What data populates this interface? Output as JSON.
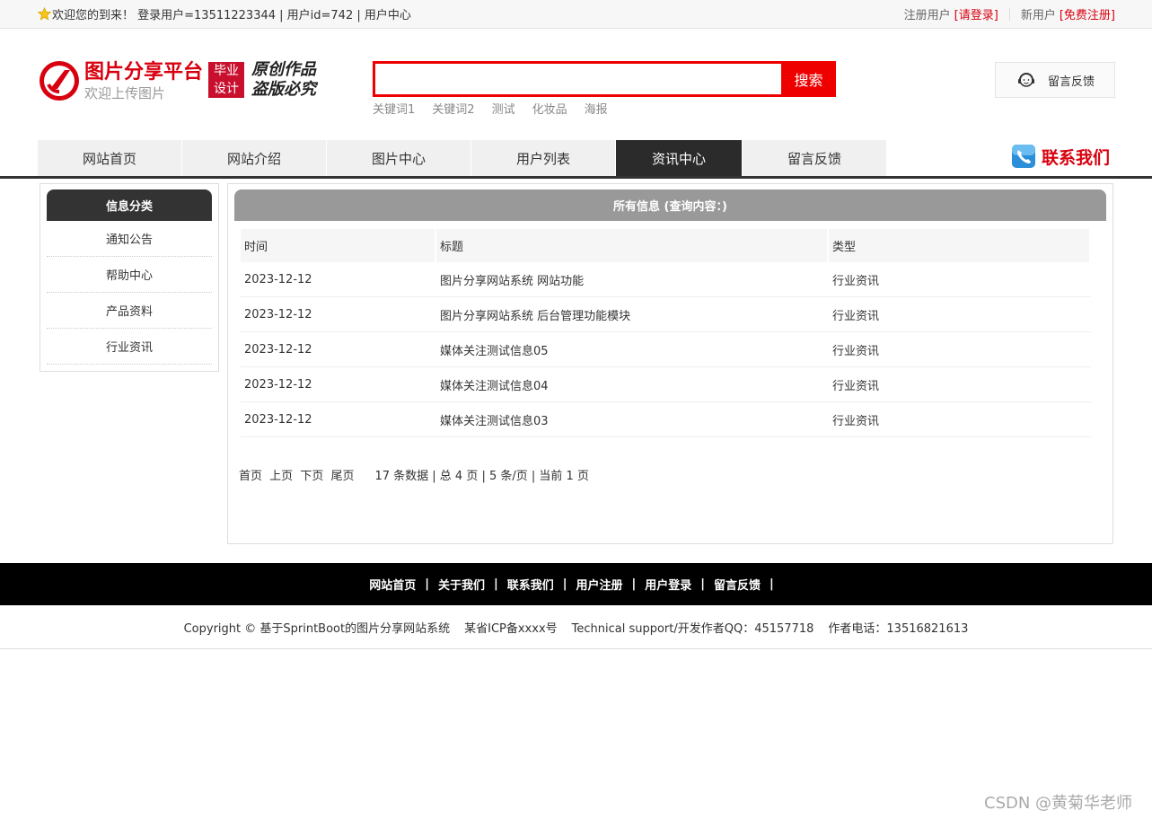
{
  "topbar": {
    "welcome": "欢迎您的到来！ 登录用户=13511223344 | 用户id=742 | 用户中心",
    "register_label": "注册用户",
    "login_link": "[请登录]",
    "new_user_label": "新用户",
    "signup_link": "[免费注册]"
  },
  "header": {
    "logo_title": "图片分享平台",
    "logo_sub": "欢迎上传图片",
    "badge_line1": "毕业",
    "badge_line2": "设计",
    "slogan_line1": "原创作品",
    "slogan_line2": "盗版必究",
    "search_placeholder": "",
    "search_button": "搜索",
    "keywords": [
      "关键词1",
      "关键词2",
      "测试",
      "化妆品",
      "海报"
    ],
    "feedback": "留言反馈"
  },
  "nav": {
    "items": [
      "网站首页",
      "网站介绍",
      "图片中心",
      "用户列表",
      "资讯中心",
      "留言反馈"
    ],
    "active_index": 4,
    "contact": "联系我们"
  },
  "sidebar": {
    "title": "信息分类",
    "items": [
      "通知公告",
      "帮助中心",
      "产品资料",
      "行业资讯"
    ]
  },
  "main": {
    "title": "所有信息 (查询内容：)",
    "columns": [
      "时间",
      "标题",
      "类型"
    ],
    "rows": [
      [
        "2023-12-12",
        "图片分享网站系统 网站功能",
        "行业资讯"
      ],
      [
        "2023-12-12",
        "图片分享网站系统 后台管理功能模块",
        "行业资讯"
      ],
      [
        "2023-12-12",
        "媒体关注测试信息05",
        "行业资讯"
      ],
      [
        "2023-12-12",
        "媒体关注测试信息04",
        "行业资讯"
      ],
      [
        "2023-12-12",
        "媒体关注测试信息03",
        "行业资讯"
      ]
    ],
    "pager": {
      "first": "首页",
      "prev": "上页",
      "next": "下页",
      "last": "尾页",
      "info": "17 条数据 | 总 4 页 | 5 条/页 | 当前 1 页"
    }
  },
  "footer": {
    "links": [
      "网站首页",
      "关于我们",
      "联系我们",
      "用户注册",
      "用户登录",
      "留言反馈"
    ],
    "copyright": "Copyright © 基于SprintBoot的图片分享网站系统",
    "icp": "某省ICP备xxxx号",
    "support": "Technical support/开发作者QQ：45157718",
    "phone": "作者电话：13516821613"
  },
  "watermark": "CSDN @黄菊华老师",
  "colors": {
    "accent": "#d8000f",
    "nav_active": "#2b2b2b",
    "panel_title": "#999999"
  }
}
